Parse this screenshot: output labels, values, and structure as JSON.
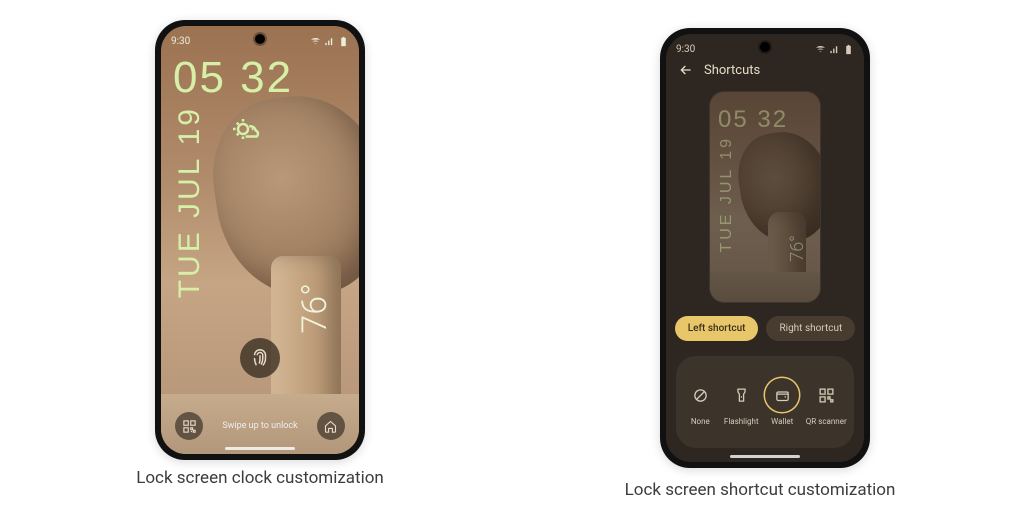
{
  "captions": {
    "clock": "Lock screen clock customization",
    "shortcut": "Lock screen shortcut customization"
  },
  "status_time": "9:30",
  "lock": {
    "clock": "05 32",
    "date": "TUE JUL 19",
    "temp": "76°",
    "swipe": "Swipe up to unlock"
  },
  "shortcuts": {
    "title": "Shortcuts",
    "tabs": {
      "left": "Left shortcut",
      "right": "Right shortcut"
    },
    "options": {
      "none": "None",
      "flashlight": "Flashlight",
      "wallet": "Wallet",
      "qr": "QR scanner"
    }
  }
}
